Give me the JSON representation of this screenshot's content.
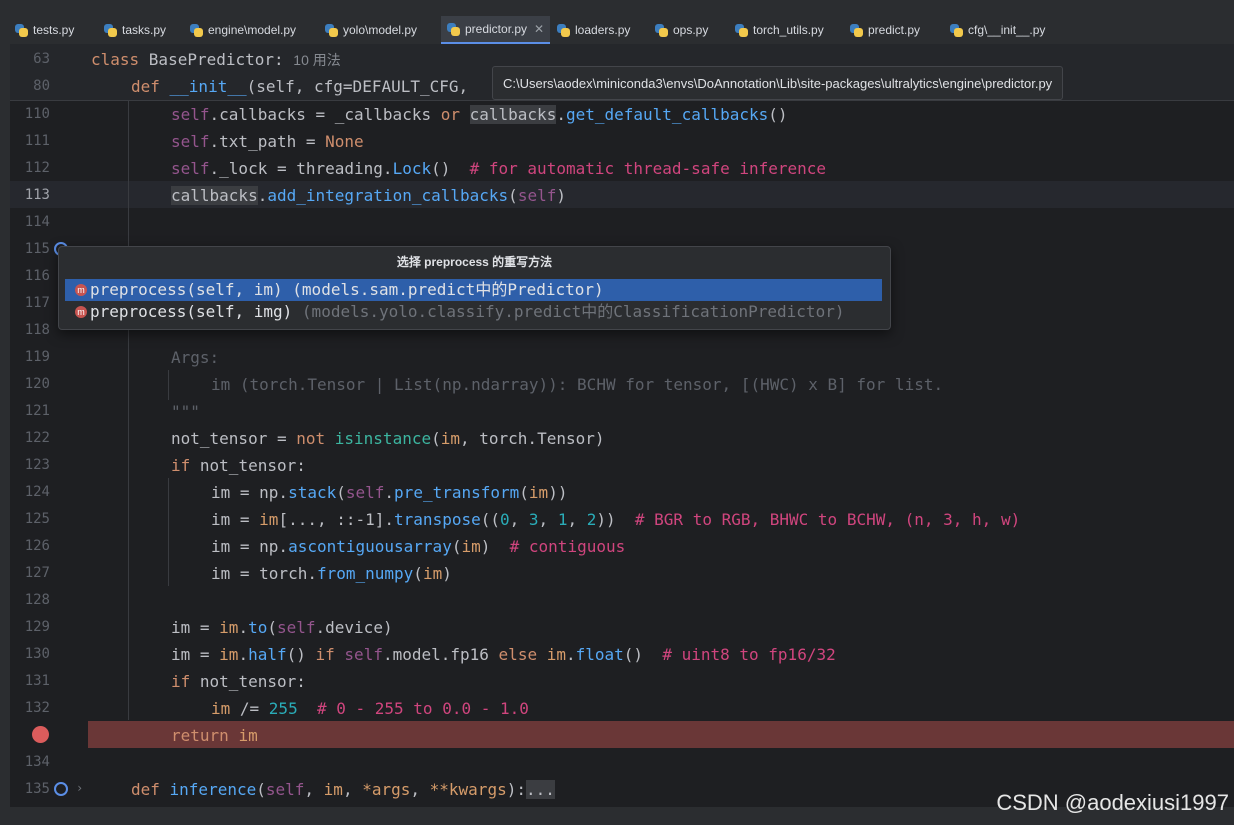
{
  "tabs": [
    {
      "label": "tests.py",
      "active": false
    },
    {
      "label": "tasks.py",
      "active": false
    },
    {
      "label": "engine\\model.py",
      "active": false
    },
    {
      "label": "yolo\\model.py",
      "active": false
    },
    {
      "label": "predictor.py",
      "active": true
    },
    {
      "label": "loaders.py",
      "active": false
    },
    {
      "label": "ops.py",
      "active": false
    },
    {
      "label": "torch_utils.py",
      "active": false
    },
    {
      "label": "predict.py",
      "active": false
    },
    {
      "label": "cfg\\__init__.py",
      "active": false
    }
  ],
  "tooltip_path": "C:\\Users\\aodex\\miniconda3\\envs\\DoAnnotation\\Lib\\site-packages\\ultralytics\\engine\\predictor.py",
  "sticky": {
    "ln63": "63",
    "ln80": "80",
    "class_kw": "class ",
    "class_name": "BasePredictor:",
    "usages": "10 用法",
    "def_kw": "def ",
    "init": "__init__",
    "init_args": "(self, cfg=DEFAULT_CFG,"
  },
  "lines": {
    "l110": "110",
    "l111": "111",
    "l112": "112",
    "l113": "113",
    "l114": "114",
    "l115": "115",
    "l116": "116",
    "l117": "117",
    "l118": "118",
    "l119": "119",
    "l120": "120",
    "l121": "121",
    "l122": "122",
    "l123": "123",
    "l124": "124",
    "l125": "125",
    "l126": "126",
    "l127": "127",
    "l128": "128",
    "l129": "129",
    "l130": "130",
    "l131": "131",
    "l132": "132",
    "l134": "134",
    "l135": "135"
  },
  "code": {
    "c110a": "self",
    "c110b": ".callbacks = _callbacks ",
    "c110c": "or ",
    "c110d": "callbacks",
    "c110e": ".",
    "c110f": "get_default_callbacks",
    "c110g": "()",
    "c111a": "self",
    "c111b": ".txt_path = ",
    "c111c": "None",
    "c112a": "self",
    "c112b": "._lock = threading.",
    "c112c": "Lock",
    "c112d": "()  ",
    "c112e": "# for automatic thread-safe inference",
    "c113a": "callbacks",
    "c113b": ".",
    "c113c": "add_integration_callbacks",
    "c113d": "(",
    "c113e": "self",
    "c113f": ")",
    "c119": "Args:",
    "c120": "im (torch.Tensor | List(np.ndarray)): BCHW for tensor, [(HWC) x B] for list.",
    "c121": "\"\"\"",
    "c122a": "not_tensor = ",
    "c122b": "not ",
    "c122c": "isinstance",
    "c122d": "(",
    "c122e": "im",
    "c122f": ", torch.Tensor)",
    "c123a": "if ",
    "c123b": "not_tensor:",
    "c124a": "im = np.",
    "c124b": "stack",
    "c124c": "(",
    "c124d": "self",
    "c124e": ".",
    "c124f": "pre_transform",
    "c124g": "(",
    "c124h": "im",
    "c124i": "))",
    "c125a": "im = ",
    "c125b": "im",
    "c125c": "[..., ::-1].",
    "c125d": "transpose",
    "c125e": "((",
    "c125f": "0",
    "c125g": ", ",
    "c125h": "3",
    "c125i": ", ",
    "c125j": "1",
    "c125k": ", ",
    "c125l": "2",
    "c125m": "))  ",
    "c125n": "# BGR to RGB, BHWC to BCHW, (n, 3, h, w)",
    "c126a": "im = np.",
    "c126b": "ascontiguousarray",
    "c126c": "(",
    "c126d": "im",
    "c126e": ")  ",
    "c126f": "# contiguous",
    "c127a": "im = torch.",
    "c127b": "from_numpy",
    "c127c": "(",
    "c127d": "im",
    "c127e": ")",
    "c129a": "im = ",
    "c129b": "im",
    "c129c": ".",
    "c129d": "to",
    "c129e": "(",
    "c129f": "self",
    "c129g": ".device)",
    "c130a": "im = ",
    "c130b": "im",
    "c130c": ".",
    "c130d": "half",
    "c130e": "() ",
    "c130f": "if ",
    "c130g": "self",
    "c130h": ".model.fp16 ",
    "c130i": "else ",
    "c130j": "im",
    "c130k": ".",
    "c130l": "float",
    "c130m": "()  ",
    "c130n": "# uint8 to fp16/32",
    "c131a": "if ",
    "c131b": "not_tensor:",
    "c132a": "im",
    "c132b": " /= ",
    "c132c": "255",
    "c132d": "  ",
    "c132e": "# 0 - 255 to 0.0 - 1.0",
    "c133a": "return ",
    "c133b": "im",
    "c135a": "def ",
    "c135b": "inference",
    "c135c": "(",
    "c135d": "self",
    "c135e": ", ",
    "c135f": "im",
    "c135g": ", ",
    "c135h": "*args",
    "c135i": ", ",
    "c135j": "**kwargs",
    "c135k": "):",
    "c135l": "..."
  },
  "popup": {
    "title": "选择 preprocess 的重写方法",
    "item1": "preprocess(self, im) (models.sam.predict中的Predictor)",
    "item2a": "preprocess(self, img) ",
    "item2b": "(models.yolo.classify.predict中的ClassificationPredictor)",
    "icon_letter": "m"
  },
  "watermark": "CSDN @aodexiusi1997"
}
